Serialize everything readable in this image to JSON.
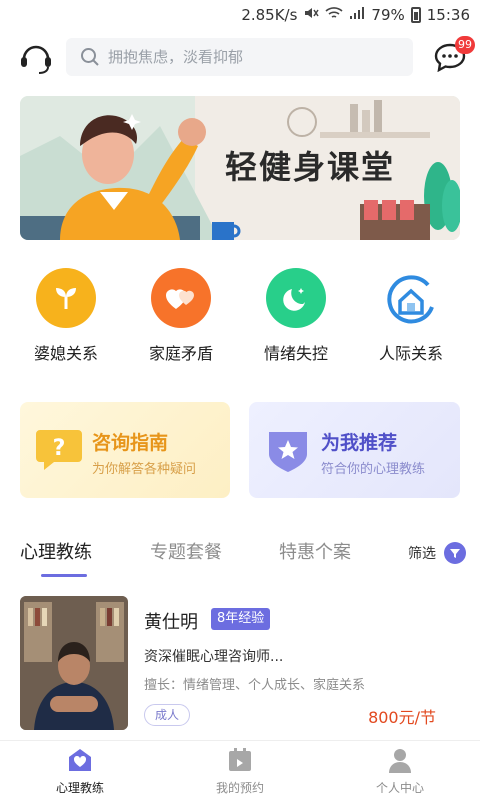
{
  "status_bar": {
    "speed": "2.85K/s",
    "battery": "79%",
    "time": "15:36"
  },
  "header": {
    "search_placeholder": "拥抱焦虑，淡看抑郁",
    "message_count": "99"
  },
  "banner": {
    "title": "轻健身课堂"
  },
  "categories": [
    {
      "label": "婆媳关系",
      "icon": "sprout-icon",
      "color": "#f7b21c"
    },
    {
      "label": "家庭矛盾",
      "icon": "hearts-icon",
      "color": "#f7732a"
    },
    {
      "label": "情绪失控",
      "icon": "moon-icon",
      "color": "#28cf8a"
    },
    {
      "label": "人际关系",
      "icon": "house-ring-icon",
      "color": "#2f8be0"
    }
  ],
  "promos": {
    "left": {
      "title": "咨询指南",
      "subtitle": "为你解答各种疑问"
    },
    "right": {
      "title": "为我推荐",
      "subtitle": "符合你的心理教练"
    }
  },
  "tabs": {
    "items": [
      "心理教练",
      "专题套餐",
      "特惠个案"
    ],
    "active": "心理教练",
    "filter_label": "筛选"
  },
  "coach": {
    "name": "黄仕明",
    "experience": "8年经验",
    "title": "资深催眠心理咨询师...",
    "specialties": "擅长：情绪管理、个人成长、家庭关系",
    "audience": "成人",
    "price": "800元/节"
  },
  "bottom_nav": [
    {
      "label": "心理教练",
      "icon": "heart-house-icon",
      "active": true
    },
    {
      "label": "我的预约",
      "icon": "calendar-icon",
      "active": false
    },
    {
      "label": "个人中心",
      "icon": "person-icon",
      "active": false
    }
  ],
  "colors": {
    "accent": "#6c6de0",
    "price": "#e2491f",
    "badge": "#f03a3a"
  }
}
